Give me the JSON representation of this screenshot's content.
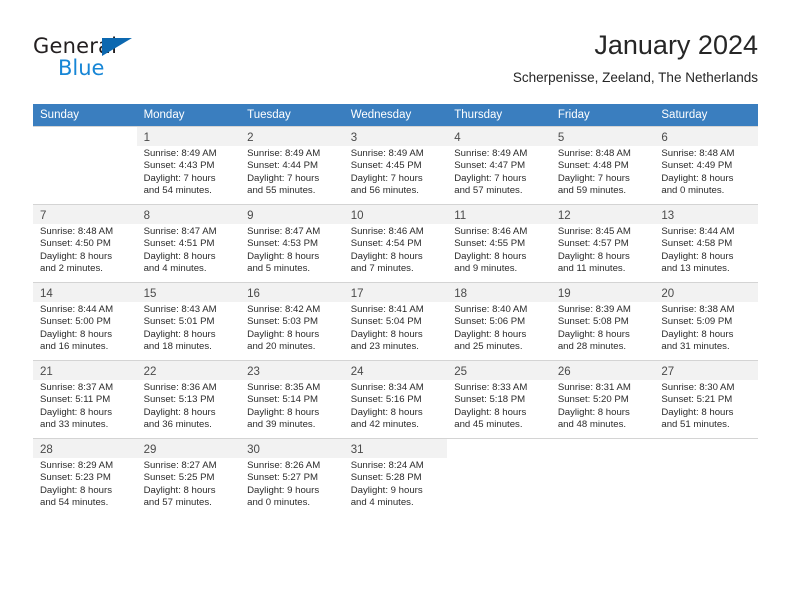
{
  "brand": {
    "name_dark": "General",
    "name_blue": "Blue",
    "triangle_color": "#0c68b0",
    "blue_color": "#1786d6"
  },
  "header": {
    "title": "January 2024",
    "subtitle": "Scherpenisse, Zeeland, The Netherlands"
  },
  "theme": {
    "header_bg": "#3a7ebf",
    "daynum_bg": "#f2f2f2",
    "grid_line": "#d4d4d4"
  },
  "weekdays": [
    "Sunday",
    "Monday",
    "Tuesday",
    "Wednesday",
    "Thursday",
    "Friday",
    "Saturday"
  ],
  "weeks": [
    [
      {
        "day": "",
        "sunrise": "",
        "sunset": "",
        "daylight1": "",
        "daylight2": "",
        "empty": true
      },
      {
        "day": "1",
        "sunrise": "Sunrise: 8:49 AM",
        "sunset": "Sunset: 4:43 PM",
        "daylight1": "Daylight: 7 hours",
        "daylight2": "and 54 minutes."
      },
      {
        "day": "2",
        "sunrise": "Sunrise: 8:49 AM",
        "sunset": "Sunset: 4:44 PM",
        "daylight1": "Daylight: 7 hours",
        "daylight2": "and 55 minutes."
      },
      {
        "day": "3",
        "sunrise": "Sunrise: 8:49 AM",
        "sunset": "Sunset: 4:45 PM",
        "daylight1": "Daylight: 7 hours",
        "daylight2": "and 56 minutes."
      },
      {
        "day": "4",
        "sunrise": "Sunrise: 8:49 AM",
        "sunset": "Sunset: 4:47 PM",
        "daylight1": "Daylight: 7 hours",
        "daylight2": "and 57 minutes."
      },
      {
        "day": "5",
        "sunrise": "Sunrise: 8:48 AM",
        "sunset": "Sunset: 4:48 PM",
        "daylight1": "Daylight: 7 hours",
        "daylight2": "and 59 minutes."
      },
      {
        "day": "6",
        "sunrise": "Sunrise: 8:48 AM",
        "sunset": "Sunset: 4:49 PM",
        "daylight1": "Daylight: 8 hours",
        "daylight2": "and 0 minutes."
      }
    ],
    [
      {
        "day": "7",
        "sunrise": "Sunrise: 8:48 AM",
        "sunset": "Sunset: 4:50 PM",
        "daylight1": "Daylight: 8 hours",
        "daylight2": "and 2 minutes."
      },
      {
        "day": "8",
        "sunrise": "Sunrise: 8:47 AM",
        "sunset": "Sunset: 4:51 PM",
        "daylight1": "Daylight: 8 hours",
        "daylight2": "and 4 minutes."
      },
      {
        "day": "9",
        "sunrise": "Sunrise: 8:47 AM",
        "sunset": "Sunset: 4:53 PM",
        "daylight1": "Daylight: 8 hours",
        "daylight2": "and 5 minutes."
      },
      {
        "day": "10",
        "sunrise": "Sunrise: 8:46 AM",
        "sunset": "Sunset: 4:54 PM",
        "daylight1": "Daylight: 8 hours",
        "daylight2": "and 7 minutes."
      },
      {
        "day": "11",
        "sunrise": "Sunrise: 8:46 AM",
        "sunset": "Sunset: 4:55 PM",
        "daylight1": "Daylight: 8 hours",
        "daylight2": "and 9 minutes."
      },
      {
        "day": "12",
        "sunrise": "Sunrise: 8:45 AM",
        "sunset": "Sunset: 4:57 PM",
        "daylight1": "Daylight: 8 hours",
        "daylight2": "and 11 minutes."
      },
      {
        "day": "13",
        "sunrise": "Sunrise: 8:44 AM",
        "sunset": "Sunset: 4:58 PM",
        "daylight1": "Daylight: 8 hours",
        "daylight2": "and 13 minutes."
      }
    ],
    [
      {
        "day": "14",
        "sunrise": "Sunrise: 8:44 AM",
        "sunset": "Sunset: 5:00 PM",
        "daylight1": "Daylight: 8 hours",
        "daylight2": "and 16 minutes."
      },
      {
        "day": "15",
        "sunrise": "Sunrise: 8:43 AM",
        "sunset": "Sunset: 5:01 PM",
        "daylight1": "Daylight: 8 hours",
        "daylight2": "and 18 minutes."
      },
      {
        "day": "16",
        "sunrise": "Sunrise: 8:42 AM",
        "sunset": "Sunset: 5:03 PM",
        "daylight1": "Daylight: 8 hours",
        "daylight2": "and 20 minutes."
      },
      {
        "day": "17",
        "sunrise": "Sunrise: 8:41 AM",
        "sunset": "Sunset: 5:04 PM",
        "daylight1": "Daylight: 8 hours",
        "daylight2": "and 23 minutes."
      },
      {
        "day": "18",
        "sunrise": "Sunrise: 8:40 AM",
        "sunset": "Sunset: 5:06 PM",
        "daylight1": "Daylight: 8 hours",
        "daylight2": "and 25 minutes."
      },
      {
        "day": "19",
        "sunrise": "Sunrise: 8:39 AM",
        "sunset": "Sunset: 5:08 PM",
        "daylight1": "Daylight: 8 hours",
        "daylight2": "and 28 minutes."
      },
      {
        "day": "20",
        "sunrise": "Sunrise: 8:38 AM",
        "sunset": "Sunset: 5:09 PM",
        "daylight1": "Daylight: 8 hours",
        "daylight2": "and 31 minutes."
      }
    ],
    [
      {
        "day": "21",
        "sunrise": "Sunrise: 8:37 AM",
        "sunset": "Sunset: 5:11 PM",
        "daylight1": "Daylight: 8 hours",
        "daylight2": "and 33 minutes."
      },
      {
        "day": "22",
        "sunrise": "Sunrise: 8:36 AM",
        "sunset": "Sunset: 5:13 PM",
        "daylight1": "Daylight: 8 hours",
        "daylight2": "and 36 minutes."
      },
      {
        "day": "23",
        "sunrise": "Sunrise: 8:35 AM",
        "sunset": "Sunset: 5:14 PM",
        "daylight1": "Daylight: 8 hours",
        "daylight2": "and 39 minutes."
      },
      {
        "day": "24",
        "sunrise": "Sunrise: 8:34 AM",
        "sunset": "Sunset: 5:16 PM",
        "daylight1": "Daylight: 8 hours",
        "daylight2": "and 42 minutes."
      },
      {
        "day": "25",
        "sunrise": "Sunrise: 8:33 AM",
        "sunset": "Sunset: 5:18 PM",
        "daylight1": "Daylight: 8 hours",
        "daylight2": "and 45 minutes."
      },
      {
        "day": "26",
        "sunrise": "Sunrise: 8:31 AM",
        "sunset": "Sunset: 5:20 PM",
        "daylight1": "Daylight: 8 hours",
        "daylight2": "and 48 minutes."
      },
      {
        "day": "27",
        "sunrise": "Sunrise: 8:30 AM",
        "sunset": "Sunset: 5:21 PM",
        "daylight1": "Daylight: 8 hours",
        "daylight2": "and 51 minutes."
      }
    ],
    [
      {
        "day": "28",
        "sunrise": "Sunrise: 8:29 AM",
        "sunset": "Sunset: 5:23 PM",
        "daylight1": "Daylight: 8 hours",
        "daylight2": "and 54 minutes."
      },
      {
        "day": "29",
        "sunrise": "Sunrise: 8:27 AM",
        "sunset": "Sunset: 5:25 PM",
        "daylight1": "Daylight: 8 hours",
        "daylight2": "and 57 minutes."
      },
      {
        "day": "30",
        "sunrise": "Sunrise: 8:26 AM",
        "sunset": "Sunset: 5:27 PM",
        "daylight1": "Daylight: 9 hours",
        "daylight2": "and 0 minutes."
      },
      {
        "day": "31",
        "sunrise": "Sunrise: 8:24 AM",
        "sunset": "Sunset: 5:28 PM",
        "daylight1": "Daylight: 9 hours",
        "daylight2": "and 4 minutes."
      },
      {
        "day": "",
        "sunrise": "",
        "sunset": "",
        "daylight1": "",
        "daylight2": "",
        "empty": true
      },
      {
        "day": "",
        "sunrise": "",
        "sunset": "",
        "daylight1": "",
        "daylight2": "",
        "empty": true
      },
      {
        "day": "",
        "sunrise": "",
        "sunset": "",
        "daylight1": "",
        "daylight2": "",
        "empty": true
      }
    ]
  ]
}
